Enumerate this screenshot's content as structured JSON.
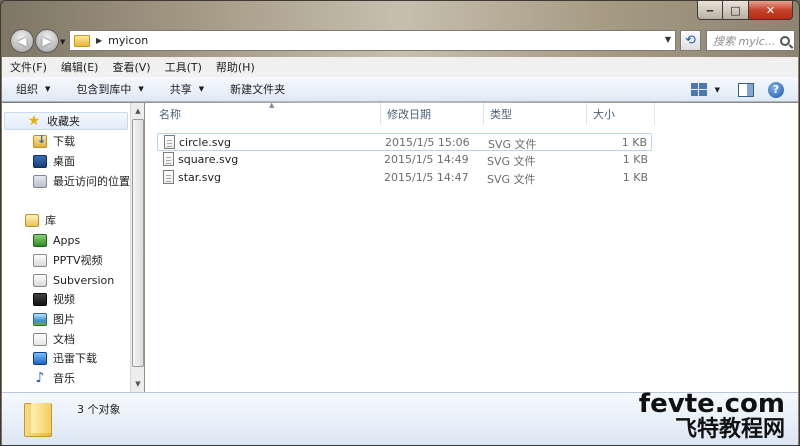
{
  "address": {
    "path_segment": "myicon"
  },
  "search": {
    "placeholder": "搜索 myic..."
  },
  "menubar": [
    {
      "label": "文件(F)"
    },
    {
      "label": "编辑(E)"
    },
    {
      "label": "查看(V)"
    },
    {
      "label": "工具(T)"
    },
    {
      "label": "帮助(H)"
    }
  ],
  "toolbar": {
    "organize": "组织",
    "include": "包含到库中",
    "share": "共享",
    "new_folder": "新建文件夹"
  },
  "navpane": {
    "favorites": "收藏夹",
    "downloads": "下载",
    "desktop": "桌面",
    "recent": "最近访问的位置",
    "libraries": "库",
    "apps": "Apps",
    "pptv": "PPTV视频",
    "subversion": "Subversion",
    "videos": "视频",
    "pictures": "图片",
    "documents": "文档",
    "thunder": "迅雷下载",
    "music": "音乐"
  },
  "columns": {
    "name": "名称",
    "modified": "修改日期",
    "type": "类型",
    "size": "大小"
  },
  "files": [
    {
      "name": "circle.svg",
      "modified": "2015/1/5 15:06",
      "type": "SVG 文件",
      "size": "1 KB"
    },
    {
      "name": "square.svg",
      "modified": "2015/1/5 14:49",
      "type": "SVG 文件",
      "size": "1 KB"
    },
    {
      "name": "star.svg",
      "modified": "2015/1/5 14:47",
      "type": "SVG 文件",
      "size": "1 KB"
    }
  ],
  "status": {
    "count": "3 个对象"
  },
  "watermark": {
    "line1": "fevte.com",
    "line2": "飞特教程网"
  }
}
